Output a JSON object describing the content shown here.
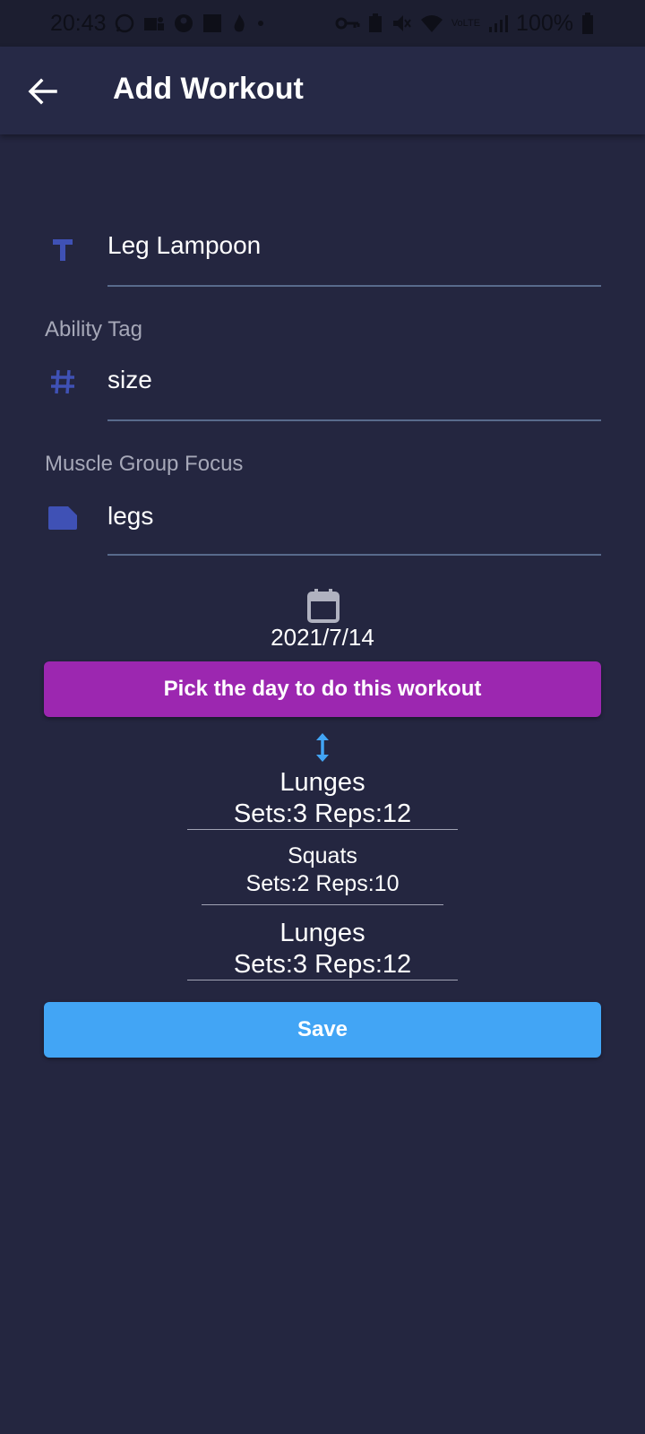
{
  "status_bar": {
    "time": "20:43",
    "battery": "100%",
    "left_icons": [
      "whatsapp-icon",
      "teams-icon",
      "account-icon",
      "app-icon",
      "fire-icon",
      "dot-icon"
    ],
    "right_icons": [
      "vpn-key-icon",
      "battery-saver-icon",
      "mute-icon",
      "wifi-icon",
      "signal-icon",
      "battery-icon"
    ],
    "network_label": "VoLTE"
  },
  "app_bar": {
    "title": "Add Workout"
  },
  "form": {
    "name_value": "Leg Lampoon",
    "ability_tag_label": "Ability Tag",
    "ability_tag_value": "size",
    "muscle_group_label": "Muscle Group Focus",
    "muscle_group_value": "legs"
  },
  "date": {
    "value": "2021/7/14"
  },
  "buttons": {
    "pick_day_label": "Pick the day to do this workout",
    "save_label": "Save"
  },
  "exercises": [
    {
      "name": "Lunges",
      "detail": "Sets:3 Reps:12"
    },
    {
      "name": "Squats",
      "detail": "Sets:2 Reps:10"
    },
    {
      "name": "Lunges",
      "detail": "Sets:3 Reps:12"
    }
  ],
  "colors": {
    "background": "#242640",
    "app_bar": "#262946",
    "accent_icon": "#3f51b5",
    "pick_button": "#9c27b0",
    "save_button": "#42a5f5",
    "reorder_icon": "#42a5f5"
  }
}
